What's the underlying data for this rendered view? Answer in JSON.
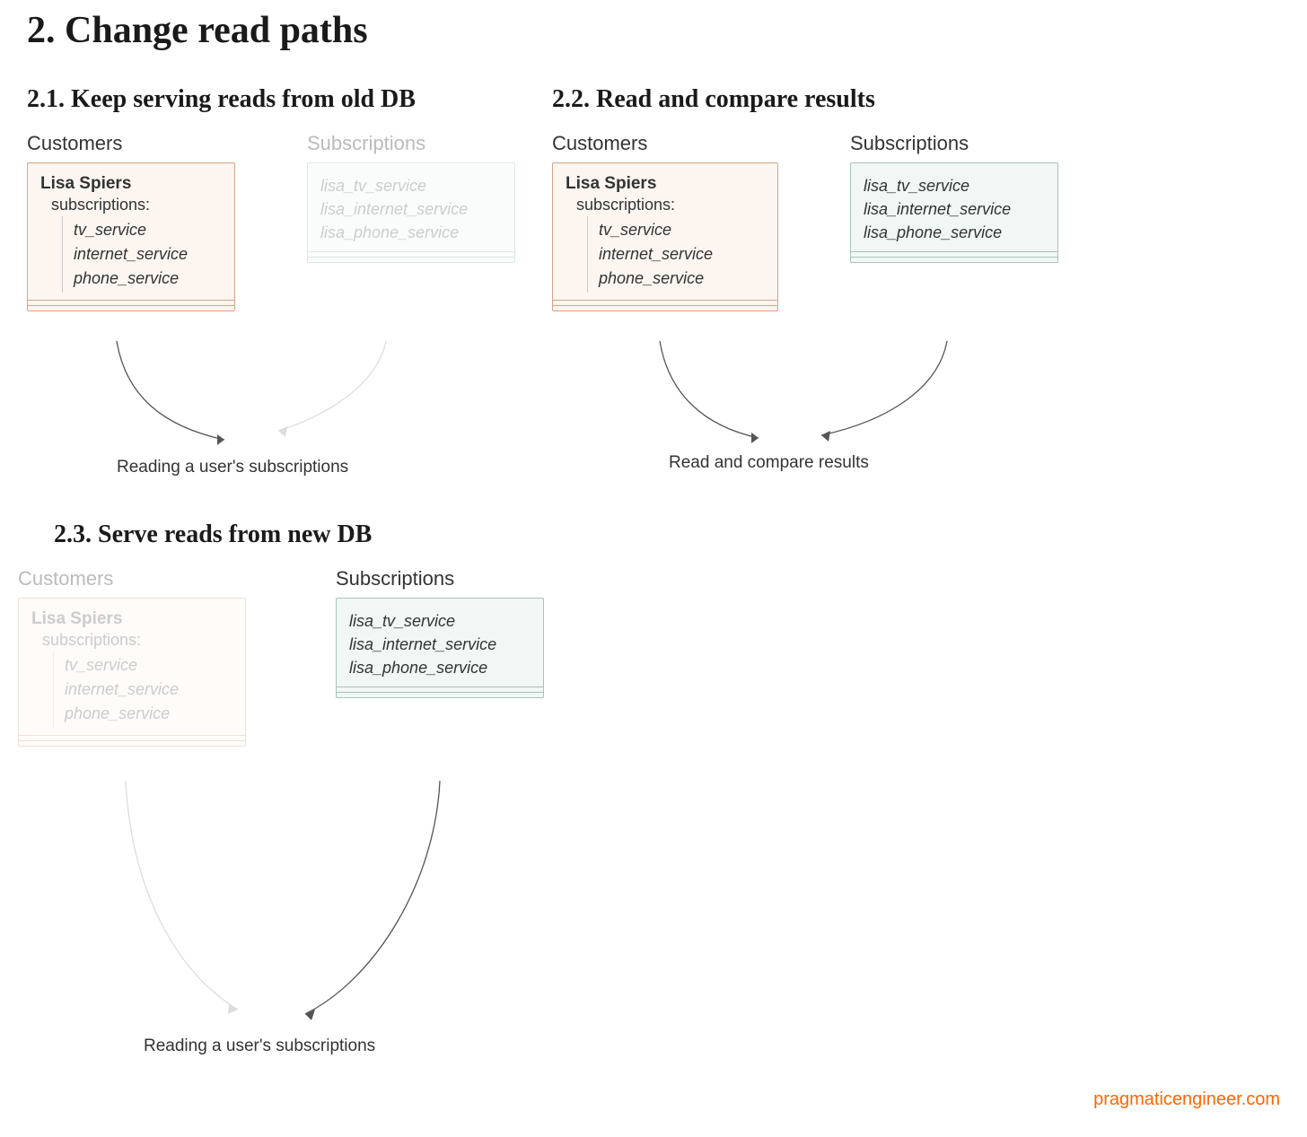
{
  "main_title": "2. Change read paths",
  "sections": {
    "s21": {
      "title": "2.1. Keep serving reads from old DB",
      "customers_title": "Customers",
      "subscriptions_title": "Subscriptions",
      "customer_name": "Lisa Spiers",
      "sub_label": "subscriptions:",
      "subs": [
        "tv_service",
        "internet_service",
        "phone_service"
      ],
      "ext_subs": [
        "lisa_tv_service",
        "lisa_internet_service",
        "lisa_phone_service"
      ],
      "caption": "Reading a user's subscriptions"
    },
    "s22": {
      "title": "2.2. Read and compare results",
      "customers_title": "Customers",
      "subscriptions_title": "Subscriptions",
      "customer_name": "Lisa Spiers",
      "sub_label": "subscriptions:",
      "subs": [
        "tv_service",
        "internet_service",
        "phone_service"
      ],
      "ext_subs": [
        "lisa_tv_service",
        "lisa_internet_service",
        "lisa_phone_service"
      ],
      "caption": "Read and compare results"
    },
    "s23": {
      "title": "2.3. Serve reads from new DB",
      "customers_title": "Customers",
      "subscriptions_title": "Subscriptions",
      "customer_name": "Lisa Spiers",
      "sub_label": "subscriptions:",
      "subs": [
        "tv_service",
        "internet_service",
        "phone_service"
      ],
      "ext_subs": [
        "lisa_tv_service",
        "lisa_internet_service",
        "lisa_phone_service"
      ],
      "caption": "Reading a user's subscriptions"
    }
  },
  "attribution": "pragmaticengineer.com"
}
